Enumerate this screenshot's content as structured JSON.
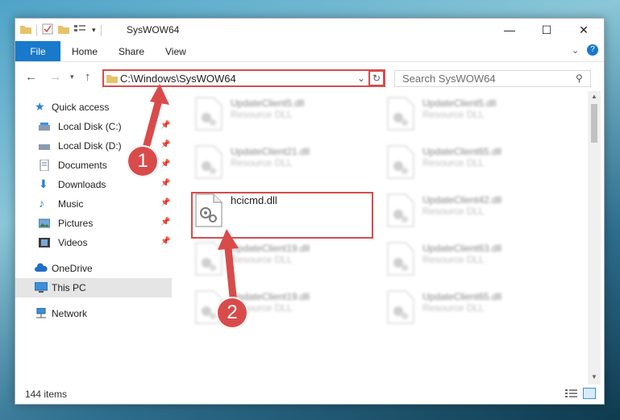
{
  "window": {
    "title": "SysWOW64"
  },
  "ribbon": {
    "tabs": [
      "File",
      "Home",
      "Share",
      "View"
    ]
  },
  "address": {
    "path": "C:\\Windows\\SysWOW64"
  },
  "search": {
    "placeholder": "Search SysWOW64"
  },
  "sidebar": {
    "items": [
      {
        "label": "Quick access",
        "icon": "star-icon"
      },
      {
        "label": "Local Disk (C:)",
        "icon": "drive-icon",
        "pinned": true
      },
      {
        "label": "Local Disk (D:)",
        "icon": "drive-icon",
        "pinned": true
      },
      {
        "label": "Documents",
        "icon": "documents-icon",
        "pinned": true
      },
      {
        "label": "Downloads",
        "icon": "download-icon",
        "pinned": true
      },
      {
        "label": "Music",
        "icon": "music-icon",
        "pinned": true
      },
      {
        "label": "Pictures",
        "icon": "pictures-icon",
        "pinned": true
      },
      {
        "label": "Videos",
        "icon": "videos-icon",
        "pinned": true
      },
      {
        "label": "OneDrive",
        "icon": "cloud-icon"
      },
      {
        "label": "This PC",
        "icon": "computer-icon",
        "selected": true
      },
      {
        "label": "Network",
        "icon": "network-icon"
      }
    ]
  },
  "files": [
    {
      "name": "UpdateClient5.dll",
      "type": "Resource DLL"
    },
    {
      "name": "UpdateClient5.dll",
      "type": "Resource DLL"
    },
    {
      "name": "UpdateClient21.dll",
      "type": "Resource DLL"
    },
    {
      "name": "UpdateClient65.dll",
      "type": "Resource DLL"
    },
    {
      "name": "hcicmd.dll",
      "type": ""
    },
    {
      "name": "UpdateClient42.dll",
      "type": "Resource DLL"
    },
    {
      "name": "UpdateClient19.dll",
      "type": "Resource DLL"
    },
    {
      "name": "UpdateClient63.dll",
      "type": "Resource DLL"
    },
    {
      "name": "UpdateClient19.dll",
      "type": "Resource DLL"
    },
    {
      "name": "UpdateClient65.dll",
      "type": "Resource DLL"
    }
  ],
  "status": {
    "count": "144 items"
  },
  "annotations": {
    "step1": "1",
    "step2": "2"
  },
  "colors": {
    "accent": "#1979ca",
    "highlight": "#d94b4b"
  }
}
